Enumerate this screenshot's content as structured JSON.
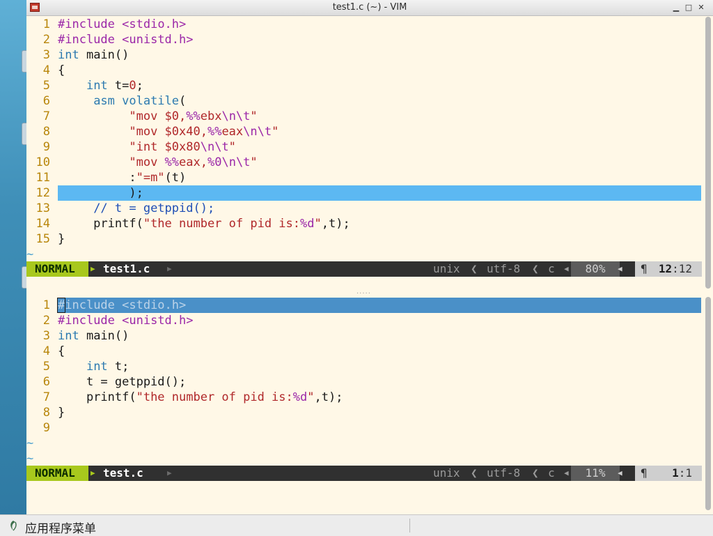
{
  "window": {
    "title": "test1.c (~) - VIM"
  },
  "top_pane": {
    "lines": [
      {
        "n": "1",
        "segments": [
          [
            "pre",
            "#include"
          ],
          [
            "txt",
            " "
          ],
          [
            "pre",
            "<stdio.h>"
          ]
        ]
      },
      {
        "n": "2",
        "segments": [
          [
            "pre",
            "#include"
          ],
          [
            "txt",
            " "
          ],
          [
            "pre",
            "<unistd.h>"
          ]
        ]
      },
      {
        "n": "3",
        "segments": [
          [
            "type",
            "int"
          ],
          [
            "txt",
            " main()"
          ]
        ]
      },
      {
        "n": "4",
        "segments": [
          [
            "txt",
            "{"
          ]
        ]
      },
      {
        "n": "5",
        "segments": [
          [
            "txt",
            "    "
          ],
          [
            "type",
            "int"
          ],
          [
            "txt",
            " t="
          ],
          [
            "num",
            "0"
          ],
          [
            "txt",
            ";"
          ]
        ]
      },
      {
        "n": "6",
        "segments": [
          [
            "txt",
            "     "
          ],
          [
            "type",
            "asm volatile"
          ],
          [
            "txt",
            "("
          ]
        ]
      },
      {
        "n": "7",
        "segments": [
          [
            "txt",
            "          "
          ],
          [
            "str",
            "\"mov $0,"
          ],
          [
            "esc",
            "%%"
          ],
          [
            "str",
            "ebx"
          ],
          [
            "esc",
            "\\n\\t"
          ],
          [
            "str",
            "\""
          ]
        ]
      },
      {
        "n": "8",
        "segments": [
          [
            "txt",
            "          "
          ],
          [
            "str",
            "\"mov $0x40,"
          ],
          [
            "esc",
            "%%"
          ],
          [
            "str",
            "eax"
          ],
          [
            "esc",
            "\\n\\t"
          ],
          [
            "str",
            "\""
          ]
        ]
      },
      {
        "n": "9",
        "segments": [
          [
            "txt",
            "          "
          ],
          [
            "str",
            "\"int $0x80"
          ],
          [
            "esc",
            "\\n\\t"
          ],
          [
            "str",
            "\""
          ]
        ]
      },
      {
        "n": "10",
        "segments": [
          [
            "txt",
            "          "
          ],
          [
            "str",
            "\"mov "
          ],
          [
            "esc",
            "%%"
          ],
          [
            "str",
            "eax,"
          ],
          [
            "esc",
            "%0"
          ],
          [
            "esc",
            "\\n\\t"
          ],
          [
            "str",
            "\""
          ]
        ]
      },
      {
        "n": "11",
        "segments": [
          [
            "txt",
            "          :"
          ],
          [
            "str",
            "\"=m\""
          ],
          [
            "txt",
            "(t)"
          ]
        ]
      },
      {
        "n": "12",
        "segments": [
          [
            "txt",
            "          );"
          ]
        ]
      },
      {
        "n": "13",
        "segments": [
          [
            "txt",
            "     "
          ],
          [
            "com",
            "// t = getppid();"
          ]
        ]
      },
      {
        "n": "14",
        "segments": [
          [
            "txt",
            "     printf("
          ],
          [
            "str",
            "\"the number of pid is:"
          ],
          [
            "esc",
            "%d"
          ],
          [
            "str",
            "\""
          ],
          [
            "txt",
            ",t);"
          ]
        ]
      },
      {
        "n": "15",
        "segments": [
          [
            "txt",
            "}"
          ]
        ]
      }
    ],
    "tilde": "~",
    "status": {
      "mode": "NORMAL",
      "file": "test1.c",
      "format": "unix",
      "encoding": "utf-8",
      "filetype": "c",
      "percent": "80%",
      "line": "12",
      "col": "12"
    }
  },
  "bottom_pane": {
    "lines": [
      {
        "n": "1",
        "segments": [
          [
            "pre",
            "#include <stdio.h>"
          ]
        ]
      },
      {
        "n": "2",
        "segments": [
          [
            "pre",
            "#include"
          ],
          [
            "txt",
            " "
          ],
          [
            "pre",
            "<unistd.h>"
          ]
        ]
      },
      {
        "n": "3",
        "segments": [
          [
            "type",
            "int"
          ],
          [
            "txt",
            " main()"
          ]
        ]
      },
      {
        "n": "4",
        "segments": [
          [
            "txt",
            "{"
          ]
        ]
      },
      {
        "n": "5",
        "segments": [
          [
            "txt",
            "    "
          ],
          [
            "type",
            "int"
          ],
          [
            "txt",
            " t;"
          ]
        ]
      },
      {
        "n": "6",
        "segments": [
          [
            "txt",
            "    t = getppid();"
          ]
        ]
      },
      {
        "n": "7",
        "segments": [
          [
            "txt",
            "    printf("
          ],
          [
            "str",
            "\"the number of pid is:"
          ],
          [
            "esc",
            "%d"
          ],
          [
            "str",
            "\""
          ],
          [
            "txt",
            ",t);"
          ]
        ]
      },
      {
        "n": "8",
        "segments": [
          [
            "txt",
            "}"
          ]
        ]
      },
      {
        "n": "9",
        "segments": []
      }
    ],
    "tilde": "~",
    "status": {
      "mode": "NORMAL",
      "file": "test.c",
      "format": "unix",
      "encoding": "utf-8",
      "filetype": "c",
      "percent": "11%",
      "line": "1",
      "col": "1"
    }
  },
  "taskbar": {
    "menu_label": "应用程序菜单"
  },
  "colors": {
    "background": "#fff8e7",
    "cursorline": "#5cb8f2",
    "mode": "#a8c81d",
    "statusbar": "#303030"
  }
}
